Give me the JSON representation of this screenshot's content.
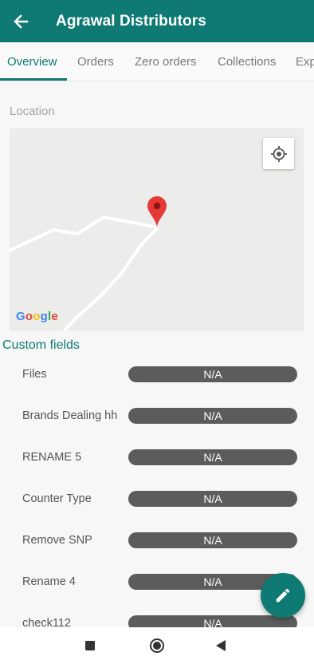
{
  "app_bar": {
    "title": "Agrawal Distributors",
    "back_icon": "arrow-left-icon",
    "color": "#0f7a73"
  },
  "tabs": [
    {
      "label": "Overview",
      "active": true
    },
    {
      "label": "Orders",
      "active": false
    },
    {
      "label": "Zero orders",
      "active": false
    },
    {
      "label": "Collections",
      "active": false
    },
    {
      "label": "Exp",
      "active": false
    }
  ],
  "location": {
    "label": "Location",
    "map_provider": "Google",
    "locate_icon": "my-location-icon",
    "pin_icon": "map-pin-icon",
    "pin_color": "#e53935"
  },
  "custom_fields": {
    "title": "Custom fields",
    "items": [
      {
        "label": "Files",
        "value": "N/A"
      },
      {
        "label": "Brands Dealing hh",
        "value": "N/A"
      },
      {
        "label": "RENAME 5",
        "value": "N/A"
      },
      {
        "label": "Counter Type",
        "value": "N/A"
      },
      {
        "label": "Remove SNP",
        "value": "N/A"
      },
      {
        "label": "Rename 4",
        "value": "N/A"
      },
      {
        "label": "check112",
        "value": "N/A"
      }
    ]
  },
  "fab": {
    "icon": "edit-pencil-icon"
  },
  "nav_bar": {
    "recents_icon": "square-recents-icon",
    "home_icon": "circle-home-icon",
    "back_icon": "triangle-back-icon"
  }
}
